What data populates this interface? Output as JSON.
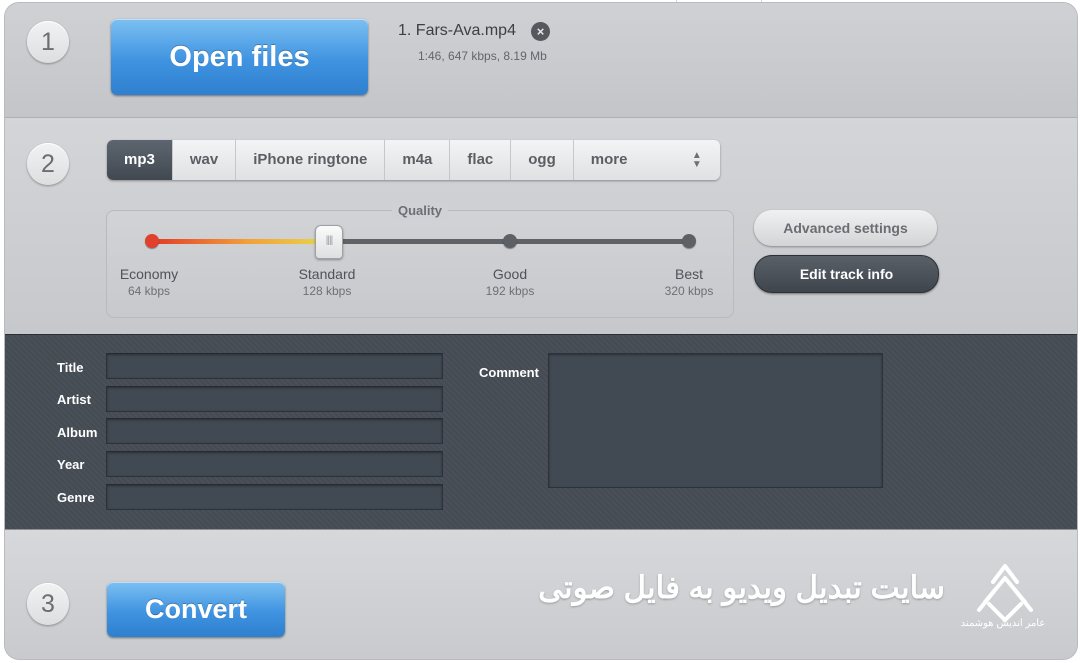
{
  "steps": [
    "1",
    "2",
    "3"
  ],
  "open_button": "Open files",
  "file": {
    "name": "1. Fars-Ava.mp4",
    "meta": "1:46, 647 kbps, 8.19 Mb",
    "remove_icon": "close-circle-icon"
  },
  "formats": {
    "items": [
      "mp3",
      "wav",
      "iPhone ringtone",
      "m4a",
      "flac",
      "ogg",
      "more"
    ],
    "selected": "mp3",
    "more_icon": "up-down-arrows-icon"
  },
  "quality": {
    "label": "Quality",
    "selected_index": 1,
    "stops": [
      {
        "name": "Economy",
        "bitrate": "64 kbps"
      },
      {
        "name": "Standard",
        "bitrate": "128 kbps"
      },
      {
        "name": "Good",
        "bitrate": "192 kbps"
      },
      {
        "name": "Best",
        "bitrate": "320 kbps"
      }
    ]
  },
  "buttons": {
    "advanced": "Advanced settings",
    "edit_track": "Edit track info"
  },
  "track_info": {
    "fields": [
      "Title",
      "Artist",
      "Album",
      "Year",
      "Genre"
    ],
    "values": [
      "",
      "",
      "",
      "",
      ""
    ],
    "comment_label": "Comment",
    "comment_value": ""
  },
  "convert_button": "Convert",
  "watermark": {
    "headline": "سایت تبدیل ویدیو به فایل صوتی",
    "logo_text": "عامر اندیش هوشمند"
  },
  "colors": {
    "accent_blue": "#3f93e0",
    "dark_panel": "#4a5058",
    "slider_red": "#e23b26",
    "slider_yellow": "#e6d84a"
  }
}
